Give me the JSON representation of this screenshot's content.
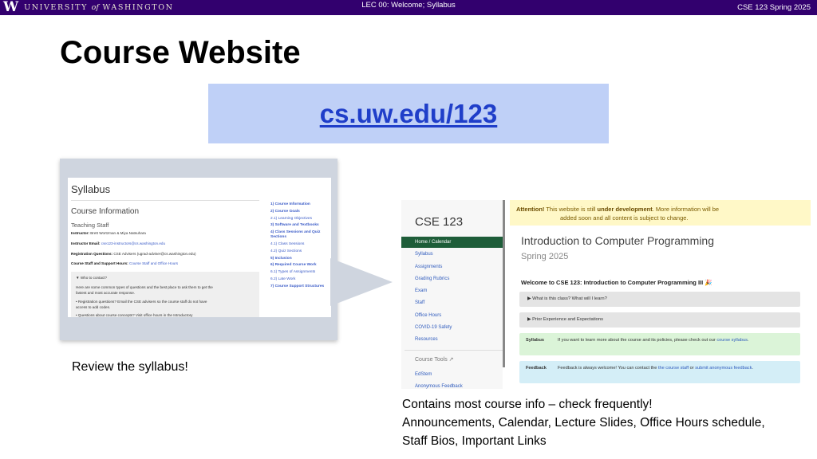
{
  "header": {
    "logo_mark": "W",
    "logo_text_1": "UNIVERSITY",
    "logo_text_of": "of",
    "logo_text_2": "WASHINGTON",
    "lecture": "LEC 00: Welcome; Syllabus",
    "course": "CSE 123 Spring 2025"
  },
  "title": "Course Website",
  "url": "cs.uw.edu/123",
  "syllabus_shot": {
    "heading": "Syllabus",
    "section": "Course Information",
    "subsection": "Teaching Staff",
    "lines": [
      {
        "label": "Instructor:",
        "text": " Brett Wortzman & Miya Natsuhara"
      },
      {
        "label": "Instructor Email:",
        "text": " cse123-instructors@cs.washington.edu"
      },
      {
        "label": "Registration Questions:",
        "text": " CSE Advisers (ugrad-adviser@cs.washington.edu)"
      },
      {
        "label": "Course Staff and Support Hours:",
        "text": " Course Staff and Office Hours"
      }
    ],
    "box_title": "▼ Who to contact?",
    "box_lines": [
      "Here are some common types of questions and the best place to ask them to get the",
      "fastest and most accurate response.",
      "• Registration questions? Email the CSE advisers so the course staff do not have",
      "   access to add codes.",
      "• Questions about course concepts? Visit office hours in the Introductory"
    ],
    "toc": [
      {
        "text": "1) Course Information",
        "bold": true
      },
      {
        "text": "2) Course Goals",
        "bold": true
      },
      {
        "text": "2.1) Learning Objectives",
        "bold": false
      },
      {
        "text": "3) Software and Textbooks",
        "bold": true
      },
      {
        "text": "4) Class Sessions and Quiz Sections",
        "bold": true
      },
      {
        "text": "4.1) Class Sessions",
        "bold": false
      },
      {
        "text": "4.2) Quiz Sections",
        "bold": false
      },
      {
        "text": "5) Inclusion",
        "bold": true
      },
      {
        "text": "6) Required Course Work",
        "bold": true
      },
      {
        "text": "6.1) Types of Assignments",
        "bold": false
      },
      {
        "text": "6.2) Late Work",
        "bold": false
      },
      {
        "text": "7) Course Support Structures",
        "bold": true
      }
    ]
  },
  "caption_left": "Review the syllabus!",
  "website_shot": {
    "logo": "CSE 123",
    "nav": [
      "Home / Calendar",
      "Syllabus",
      "Assignments",
      "Grading Rubrics",
      "Exam",
      "Staff",
      "Office Hours",
      "COVID-19 Safety",
      "Resources"
    ],
    "nav_group": "Course Tools ↗",
    "nav_tools": [
      "EdStem",
      "Anonymous Feedback"
    ],
    "attention_label": "Attention!",
    "attention_text_1": " This website is still ",
    "attention_bold": "under development",
    "attention_text_2": ". More information will be",
    "attention_text_3": "added soon and all content is subject to change.",
    "h1": "Introduction to Computer Programming",
    "h2": "Spring 2025",
    "welcome": "Welcome to CSE 123: Introduction to Computer Programming III 🎉",
    "details_1": "▶ What is this class? What will I learn?",
    "details_2": "▶ Prior Experience and Expectations",
    "syllabus_label": "Syllabus",
    "syllabus_text": "If you want to learn more about the course and its policies, please check out our ",
    "syllabus_link": "course syllabus",
    "feedback_label": "Feedback",
    "feedback_text": "Feedback is always welcome! You can contact the ",
    "feedback_link_1": "the course staff",
    "feedback_or": " or ",
    "feedback_link_2": "submit anonymous feedback",
    "period": "."
  },
  "caption_right": {
    "line1": "Contains most course info – check frequently!",
    "line2": "Announcements, Calendar, Lecture Slides, Office Hours schedule,",
    "line3": "Staff Bios, Important Links"
  },
  "colors": {
    "header_bg": "#32006e",
    "url_box": "#bfd0f7",
    "url_text": "#1f3ec9",
    "nav_active": "#1e5d39"
  }
}
